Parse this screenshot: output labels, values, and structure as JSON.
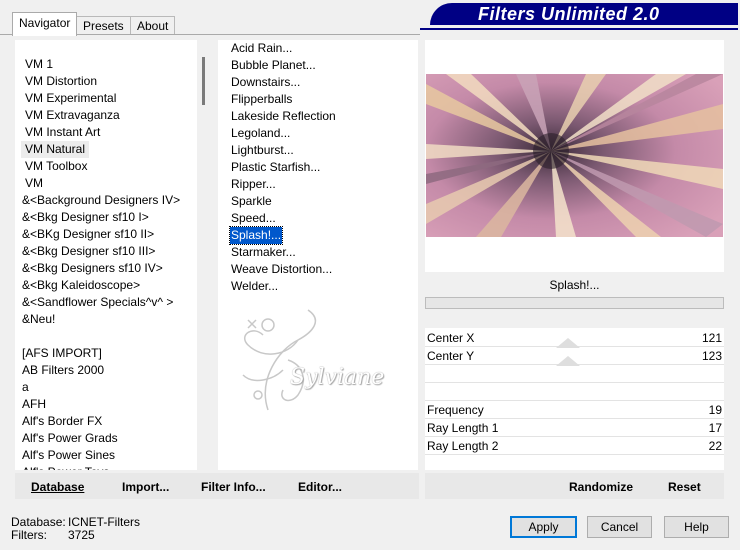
{
  "tabs": [
    {
      "label": "Navigator"
    },
    {
      "label": "Presets"
    },
    {
      "label": "About"
    }
  ],
  "banner": {
    "title": "Filters Unlimited 2.0"
  },
  "categories": [
    "VM 1",
    "VM Distortion",
    "VM Experimental",
    "VM Extravaganza",
    "VM Instant Art",
    "VM Natural",
    "VM Toolbox",
    "VM",
    "&<Background Designers IV>",
    "&<Bkg Designer sf10 I>",
    "&<BKg Designer sf10 II>",
    "&<Bkg Designer sf10 III>",
    "&<Bkg Designers sf10 IV>",
    "&<Bkg Kaleidoscope>",
    "&<Sandflower Specials^v^ >",
    "&Neu!",
    "",
    "[AFS IMPORT]",
    "AB Filters 2000",
    "a",
    "AFH",
    "Alf's Border FX",
    "Alf's Power Grads",
    "Alf's Power Sines",
    "Alf's Power Toys"
  ],
  "filters": [
    "Acid Rain...",
    "Bubble Planet...",
    "Downstairs...",
    "Flipperballs",
    "Lakeside Reflection",
    "Legoland...",
    "Lightburst...",
    "Plastic Starfish...",
    "Ripper...",
    "Sparkle",
    "Speed...",
    "Splash!...",
    "Starmaker...",
    "Weave Distortion...",
    "Welder..."
  ],
  "watermark": {
    "text": "Sylviane"
  },
  "filter_name": "Splash!...",
  "params": [
    {
      "label": "Center X",
      "value": "121"
    },
    {
      "label": "Center Y",
      "value": "123"
    },
    {
      "label": "",
      "value": ""
    },
    {
      "label": "",
      "value": ""
    },
    {
      "label": "Frequency",
      "value": "19"
    },
    {
      "label": "Ray Length 1",
      "value": "17"
    },
    {
      "label": "Ray Length 2",
      "value": "22"
    }
  ],
  "bottom_links": {
    "database": "Database",
    "import": "Import...",
    "filter_info": "Filter Info...",
    "editor": "Editor...",
    "randomize": "Randomize",
    "reset": "Reset"
  },
  "status": {
    "database_label": "Database:",
    "database_value": "ICNET-Filters",
    "filters_label": "Filters:",
    "filters_value": "3725"
  },
  "buttons": {
    "apply": "Apply",
    "cancel": "Cancel",
    "help": "Help"
  },
  "colors": {
    "selection": "#0058cc",
    "banner": "#000084"
  }
}
